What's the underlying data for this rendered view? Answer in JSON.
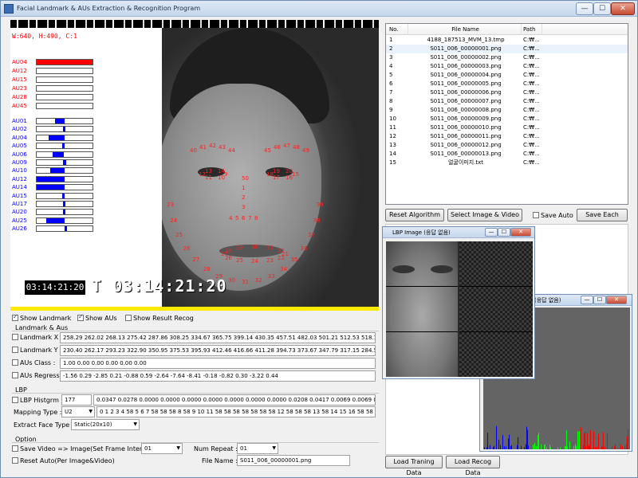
{
  "window": {
    "title": "Facial Landmark & AUs Extraction & Recognition Program",
    "min": "—",
    "max": "☐",
    "close": "✕"
  },
  "video": {
    "resolution": "W:640, H:490, C:1",
    "timestamp": "T 03:14:21:20",
    "small_timestamp": "03:14:21:20",
    "au_top": [
      {
        "label": "AU04",
        "fill": 1.0,
        "color": "#ff0000"
      },
      {
        "label": "AU12",
        "fill": 0,
        "color": "#ff0000"
      },
      {
        "label": "AU15",
        "fill": 0,
        "color": "#ff0000"
      },
      {
        "label": "AU23",
        "fill": 0,
        "color": "#ff0000"
      },
      {
        "label": "AU28",
        "fill": 0,
        "color": "#ff0000"
      },
      {
        "label": "AU45",
        "fill": 0,
        "color": "#ff0000"
      }
    ],
    "au_bottom": [
      {
        "label": "AU01",
        "start": 0.33,
        "fill": 0.17
      },
      {
        "label": "AU02",
        "start": 0.47,
        "fill": 0.04
      },
      {
        "label": "AU04",
        "start": 0.22,
        "fill": 0.28
      },
      {
        "label": "AU05",
        "start": 0.46,
        "fill": 0.04
      },
      {
        "label": "AU06",
        "start": 0.28,
        "fill": 0.2
      },
      {
        "label": "AU09",
        "start": 0.47,
        "fill": 0.06
      },
      {
        "label": "AU10",
        "start": 0.24,
        "fill": 0.26
      },
      {
        "label": "AU12",
        "start": 0.0,
        "fill": 0.5
      },
      {
        "label": "AU14",
        "start": 0.0,
        "fill": 0.5
      },
      {
        "label": "AU15",
        "start": 0.46,
        "fill": 0.04
      },
      {
        "label": "AU17",
        "start": 0.47,
        "fill": 0.04
      },
      {
        "label": "AU20",
        "start": 0.47,
        "fill": 0.04
      },
      {
        "label": "AU25",
        "start": 0.17,
        "fill": 0.33
      },
      {
        "label": "AU26",
        "start": 0.5,
        "fill": 0.04
      }
    ],
    "landmark_numbers": [
      "23",
      "24",
      "25",
      "26",
      "27",
      "28",
      "29",
      "30",
      "31",
      "32",
      "33",
      "34",
      "35",
      "36",
      "37",
      "38",
      "39",
      "40",
      "41",
      "42",
      "43",
      "44",
      "45",
      "46",
      "47",
      "48",
      "49",
      "50",
      "1",
      "2",
      "3",
      "4",
      "5",
      "6",
      "7",
      "8",
      "9",
      "10",
      "11",
      "12",
      "13",
      "14",
      "15",
      "16",
      "17",
      "18",
      "19",
      "20",
      "21",
      "22"
    ]
  },
  "checks": {
    "show_landmark": "Show Landmark",
    "show_aus": "Show AUs",
    "show_result_recog": "Show Result Recog"
  },
  "landmark_group": {
    "title": "Landmark & Aus",
    "landmark_x_label": "Landmark X :",
    "landmark_x_value": "258.29 262.02 268.13 275.42 287.86 308.25 334.67 365.75 399.14 430.35 457.51 482.03 501.21 512.53 518.16 5",
    "landmark_y_label": "Landmark Y :",
    "landmark_y_value": "230.40 262.17 293.23 322.90 350.95 375.53 395.93 412.46 416.66 411.28 394.73 373.67 347.79 317.15 284.53 2",
    "aus_class_label": "AUs Class :",
    "aus_class_value": "1.00 0.00 0.00 0.00 0.00 0.00",
    "aus_regress_label": "AUs Regress :",
    "aus_regress_value": "-1.56 0.29 -2.85 0.21 -0.88 0.59 -2.64 -7.64 -8.41 -0.18 -0.82 0.30 -3.22 0.44"
  },
  "lbp_group": {
    "title": "LBP",
    "histgrm_label": "LBP Histgrm :",
    "histgrm_count": "177",
    "histgrm_value": "0.0347 0.0278 0.0000 0.0000 0.0000 0.0000 0.0000 0.0000 0.0000 0.0208 0.0417 0.0069 0.0069 0.0",
    "mapping_label": "Mapping Type :",
    "mapping_value": "U2",
    "mapping_table": "0 1 2 3 4 58 5 6 7 58 58 58 8 58 9 10 11 58 58 58 58 58 58 58 12 58 58 58 13 58 14 15 16 58 58 58",
    "extract_label": "Extract Face Type :",
    "extract_value": "Static(20x10)"
  },
  "option_group": {
    "title": "Option",
    "save_video_label": "Save Video => Image(Set Frame Interval) :",
    "save_video_value": "01",
    "num_repeat_label": "Num Repeat :",
    "num_repeat_value": "01",
    "reset_auto_label": "Reset Auto(Per Image&Video)",
    "file_name_label": "File Name :",
    "file_name_value": "S011_006_00000001.png"
  },
  "file_list": {
    "headers": {
      "no": "No.",
      "name": "File Name",
      "path": "Path"
    },
    "rows": [
      {
        "no": "1",
        "name": "4188_187513_MVM_13.tmp",
        "path": "C:₩..."
      },
      {
        "no": "2",
        "name": "S011_006_00000001.png",
        "path": "C:₩..."
      },
      {
        "no": "3",
        "name": "S011_006_00000002.png",
        "path": "C:₩..."
      },
      {
        "no": "4",
        "name": "S011_006_00000003.png",
        "path": "C:₩..."
      },
      {
        "no": "5",
        "name": "S011_006_00000004.png",
        "path": "C:₩..."
      },
      {
        "no": "6",
        "name": "S011_006_00000005.png",
        "path": "C:₩..."
      },
      {
        "no": "7",
        "name": "S011_006_00000006.png",
        "path": "C:₩..."
      },
      {
        "no": "8",
        "name": "S011_006_00000007.png",
        "path": "C:₩..."
      },
      {
        "no": "9",
        "name": "S011_006_00000008.png",
        "path": "C:₩..."
      },
      {
        "no": "10",
        "name": "S011_006_00000009.png",
        "path": "C:₩..."
      },
      {
        "no": "11",
        "name": "S011_006_00000010.png",
        "path": "C:₩..."
      },
      {
        "no": "12",
        "name": "S011_006_00000011.png",
        "path": "C:₩..."
      },
      {
        "no": "13",
        "name": "S011_006_00000012.png",
        "path": "C:₩..."
      },
      {
        "no": "14",
        "name": "S011_006_00000013.png",
        "path": "C:₩..."
      },
      {
        "no": "15",
        "name": "얼굴이미지.txt",
        "path": "C:₩..."
      }
    ]
  },
  "buttons": {
    "reset_algorithm": "Reset Algorithm",
    "select_image_video": "Select Image & Video",
    "save_auto": "Save Auto",
    "save_each": "Save Each",
    "load_training": "Load Traning Data",
    "load_recog": "Load Recog Data"
  },
  "lbp_window": {
    "title": "LBP Image (응답 없음)"
  },
  "hist_window": {
    "title": "(응답 없음)"
  }
}
